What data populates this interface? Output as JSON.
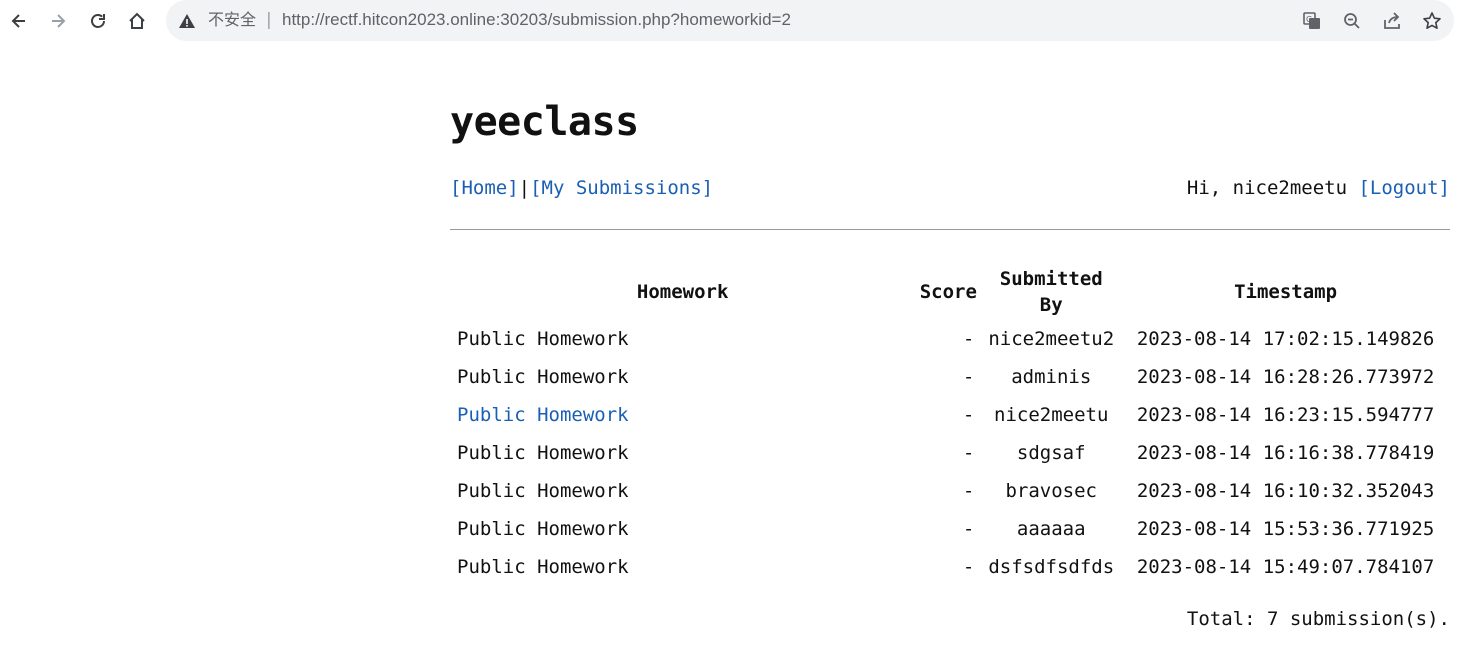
{
  "browser": {
    "security_label": "不安全",
    "separator": "|",
    "url": "http://rectf.hitcon2023.online:30203/submission.php?homeworkid=2",
    "icons": {
      "back": "arrow-left-icon",
      "forward": "arrow-right-icon",
      "reload": "reload-icon",
      "home": "home-icon",
      "warning": "warning-icon",
      "translate": "translate-icon",
      "zoom": "zoom-out-icon",
      "share": "share-icon",
      "bookmark": "star-icon"
    }
  },
  "site": {
    "title": "yeeclass"
  },
  "nav": {
    "home": "[Home]",
    "pipe": "|",
    "my_submissions": "[My Submissions]",
    "greeting": "Hi, nice2meetu ",
    "logout": "[Logout]"
  },
  "table": {
    "headers": {
      "homework": "Homework",
      "score": "Score",
      "submitted_by": "Submitted By",
      "timestamp": "Timestamp"
    },
    "rows": [
      {
        "homework": "Public Homework",
        "score": "-",
        "submitted_by": "nice2meetu2",
        "timestamp": "2023-08-14 17:02:15.149826",
        "linked": false
      },
      {
        "homework": "Public Homework",
        "score": "-",
        "submitted_by": "adminis",
        "timestamp": "2023-08-14 16:28:26.773972",
        "linked": false
      },
      {
        "homework": "Public Homework",
        "score": "-",
        "submitted_by": "nice2meetu",
        "timestamp": "2023-08-14 16:23:15.594777",
        "linked": true
      },
      {
        "homework": "Public Homework",
        "score": "-",
        "submitted_by": "sdgsaf",
        "timestamp": "2023-08-14 16:16:38.778419",
        "linked": false
      },
      {
        "homework": "Public Homework",
        "score": "-",
        "submitted_by": "bravosec",
        "timestamp": "2023-08-14 16:10:32.352043",
        "linked": false
      },
      {
        "homework": "Public Homework",
        "score": "-",
        "submitted_by": "aaaaaa",
        "timestamp": "2023-08-14 15:53:36.771925",
        "linked": false
      },
      {
        "homework": "Public Homework",
        "score": "-",
        "submitted_by": "dsfsdfsdfds",
        "timestamp": "2023-08-14 15:49:07.784107",
        "linked": false
      }
    ]
  },
  "total": "Total: 7 submission(s).",
  "colors": {
    "link": "#1a5fb4",
    "text": "#111111",
    "omnibox_bg": "#f1f3f4"
  }
}
